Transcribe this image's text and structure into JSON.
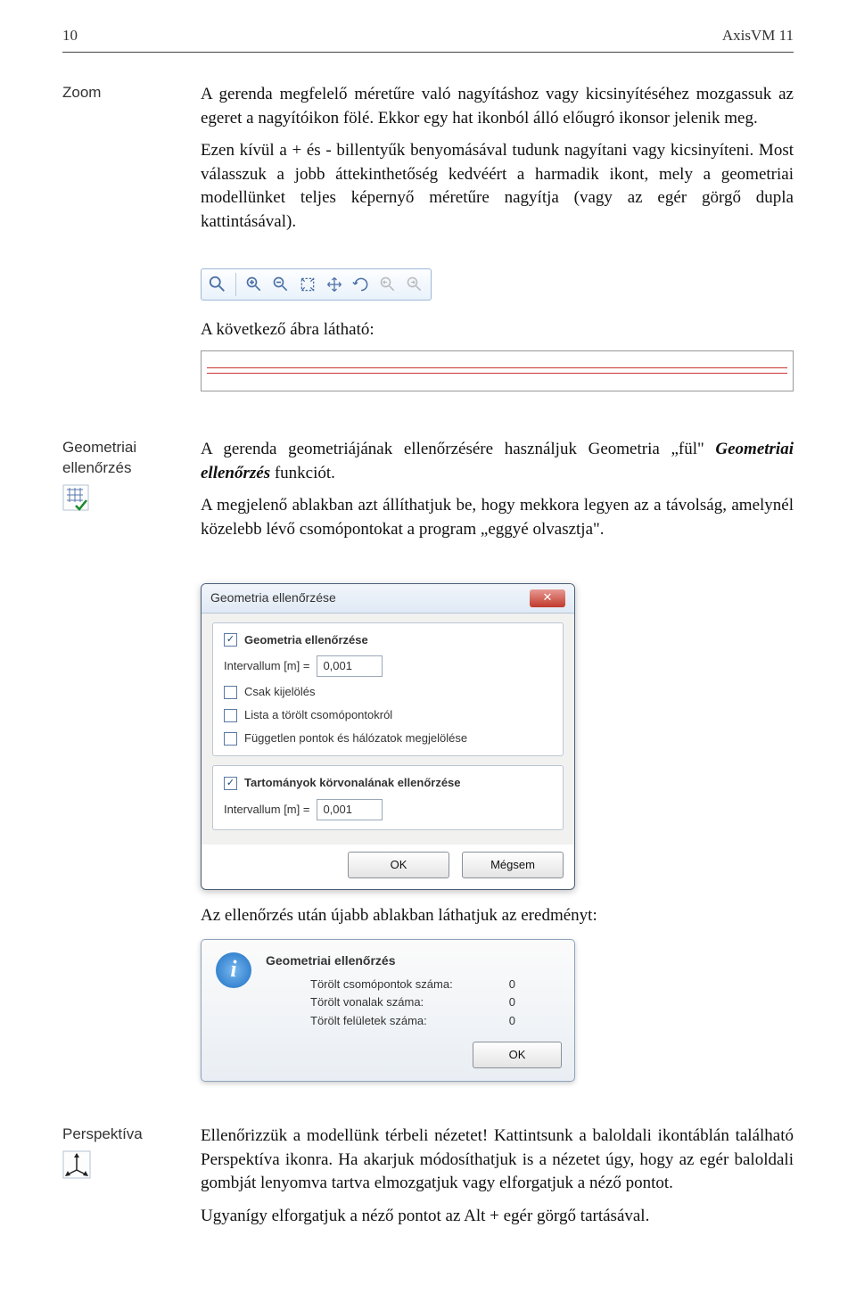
{
  "header": {
    "page_number": "10",
    "app_title": "AxisVM 11"
  },
  "sections": {
    "zoom": {
      "label": "Zoom",
      "p1": "A gerenda megfelelő méretűre való nagyításhoz vagy kicsinyítéséhez mozgassuk az egeret a nagyítóikon fölé. Ekkor egy hat ikonból álló előugró ikonsor jelenik meg.",
      "p2": "Ezen kívül a + és - billentyűk benyomásával tudunk nagyítani vagy kicsinyíteni. Most válasszuk a jobb áttekinthetőség kedvéért a harmadik ikont, mely a geometriai modellünket teljes képernyő méretűre nagyítja (vagy az egér görgő dupla kattintásával).",
      "caption": "A következő ábra látható:"
    },
    "geom_check": {
      "label": "Geometriai ellenőrzés",
      "p1_prefix": "A gerenda geometriájának ellenőrzésére használjuk Geometria „fül\" ",
      "p1_emph": "Geometriai ellenőrzés",
      "p1_suffix": " funkciót.",
      "p2": "A megjelenő ablakban azt állíthatjuk be, hogy mekkora legyen az a távolság, amelynél közelebb lévő csomópontokat a program „eggyé olvasztja\".",
      "result_caption": "Az ellenőrzés után újabb ablakban láthatjuk az eredményt:"
    },
    "dialog": {
      "title": "Geometria ellenőrzése",
      "group1_title": "Geometria ellenőrzése",
      "interval_label": "Intervallum [m] =",
      "interval_value": "0,001",
      "opt_selection": "Csak kijelölés",
      "opt_deleted_list": "Lista a törölt csomópontokról",
      "opt_independent": "Független pontok és hálózatok megjelölése",
      "group2_title": "Tartományok körvonalának ellenőrzése",
      "interval2_label": "Intervallum [m] =",
      "interval2_value": "0,001",
      "ok": "OK",
      "cancel": "Mégsem"
    },
    "info_dialog": {
      "title": "Geometriai ellenőrzés",
      "lines": [
        {
          "label": "Törölt csomópontok száma:",
          "value": "0"
        },
        {
          "label": "Törölt vonalak száma:",
          "value": "0"
        },
        {
          "label": "Törölt felületek száma:",
          "value": "0"
        }
      ],
      "ok": "OK"
    },
    "perspective": {
      "label": "Perspektíva",
      "p1": "Ellenőrizzük a modellünk térbeli nézetet! Kattintsunk a baloldali ikontáblán található Perspektíva ikonra. Ha akarjuk módosíthatjuk is a nézetet úgy, hogy az egér baloldali gombját lenyomva tartva elmozgatjuk vagy elforgatjuk a néző pontot.",
      "p2": "Ugyanígy elforgatjuk a néző pontot az Alt + egér görgő tartásával."
    }
  }
}
